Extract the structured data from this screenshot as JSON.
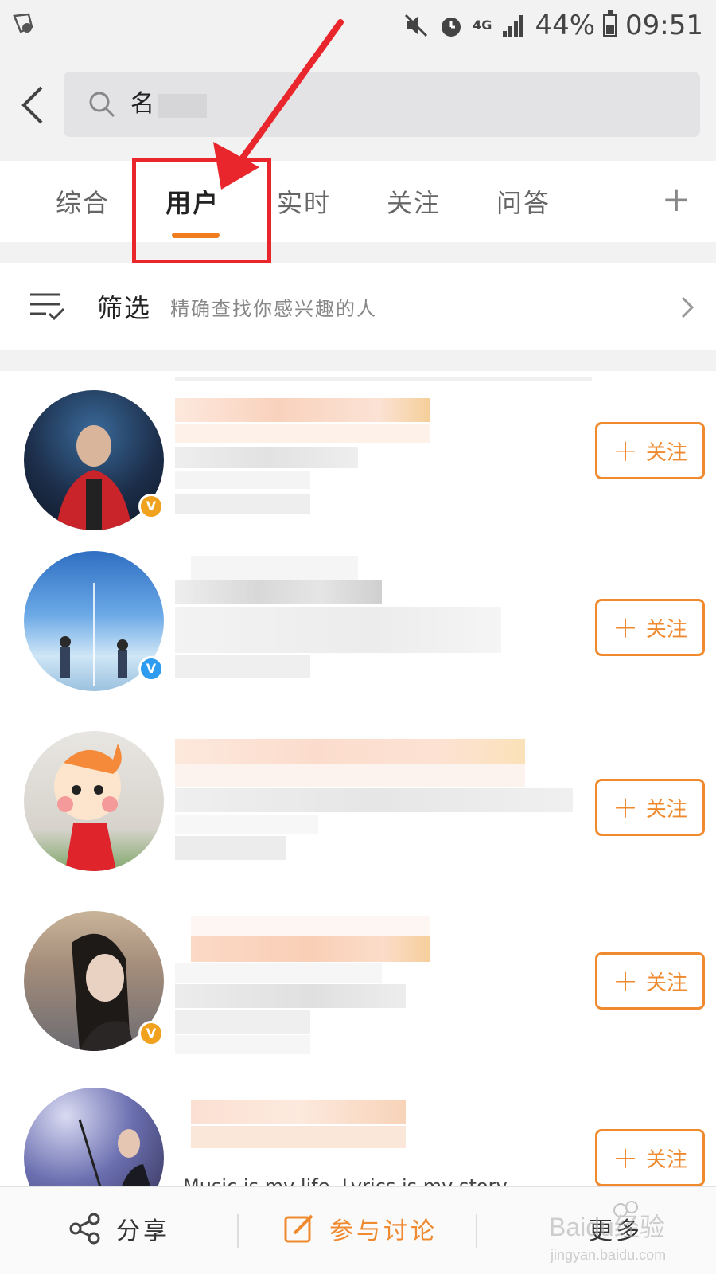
{
  "status_bar": {
    "battery": "44%",
    "time": "09:51",
    "network": "4G"
  },
  "search": {
    "query": "名"
  },
  "tabs": {
    "items": [
      {
        "label": "综合"
      },
      {
        "label": "用户",
        "active": true
      },
      {
        "label": "实时"
      },
      {
        "label": "关注"
      },
      {
        "label": "问答"
      }
    ],
    "add_label": "+"
  },
  "filter": {
    "title": "筛选",
    "description": "精确查找你感兴趣的人"
  },
  "users": [
    {
      "follow_label": "关注",
      "badge": "V",
      "badge_color": "#f0a21e"
    },
    {
      "follow_label": "关注",
      "badge": "V",
      "badge_color": "#2d9bf0"
    },
    {
      "follow_label": "关注"
    },
    {
      "follow_label": "关注",
      "badge": "V",
      "badge_color": "#f0a21e"
    },
    {
      "follow_label": "关注"
    }
  ],
  "partial_bio": "Music is my life, Lyrics is my story",
  "bottom_bar": {
    "share_label": "分享",
    "discuss_label": "参与讨论",
    "more_label": "更多"
  },
  "watermark": {
    "brand": "Baidu经验",
    "url": "jingyan.baidu.com"
  },
  "colors": {
    "accent": "#f07c1e",
    "annotation_red": "#e8262b"
  }
}
